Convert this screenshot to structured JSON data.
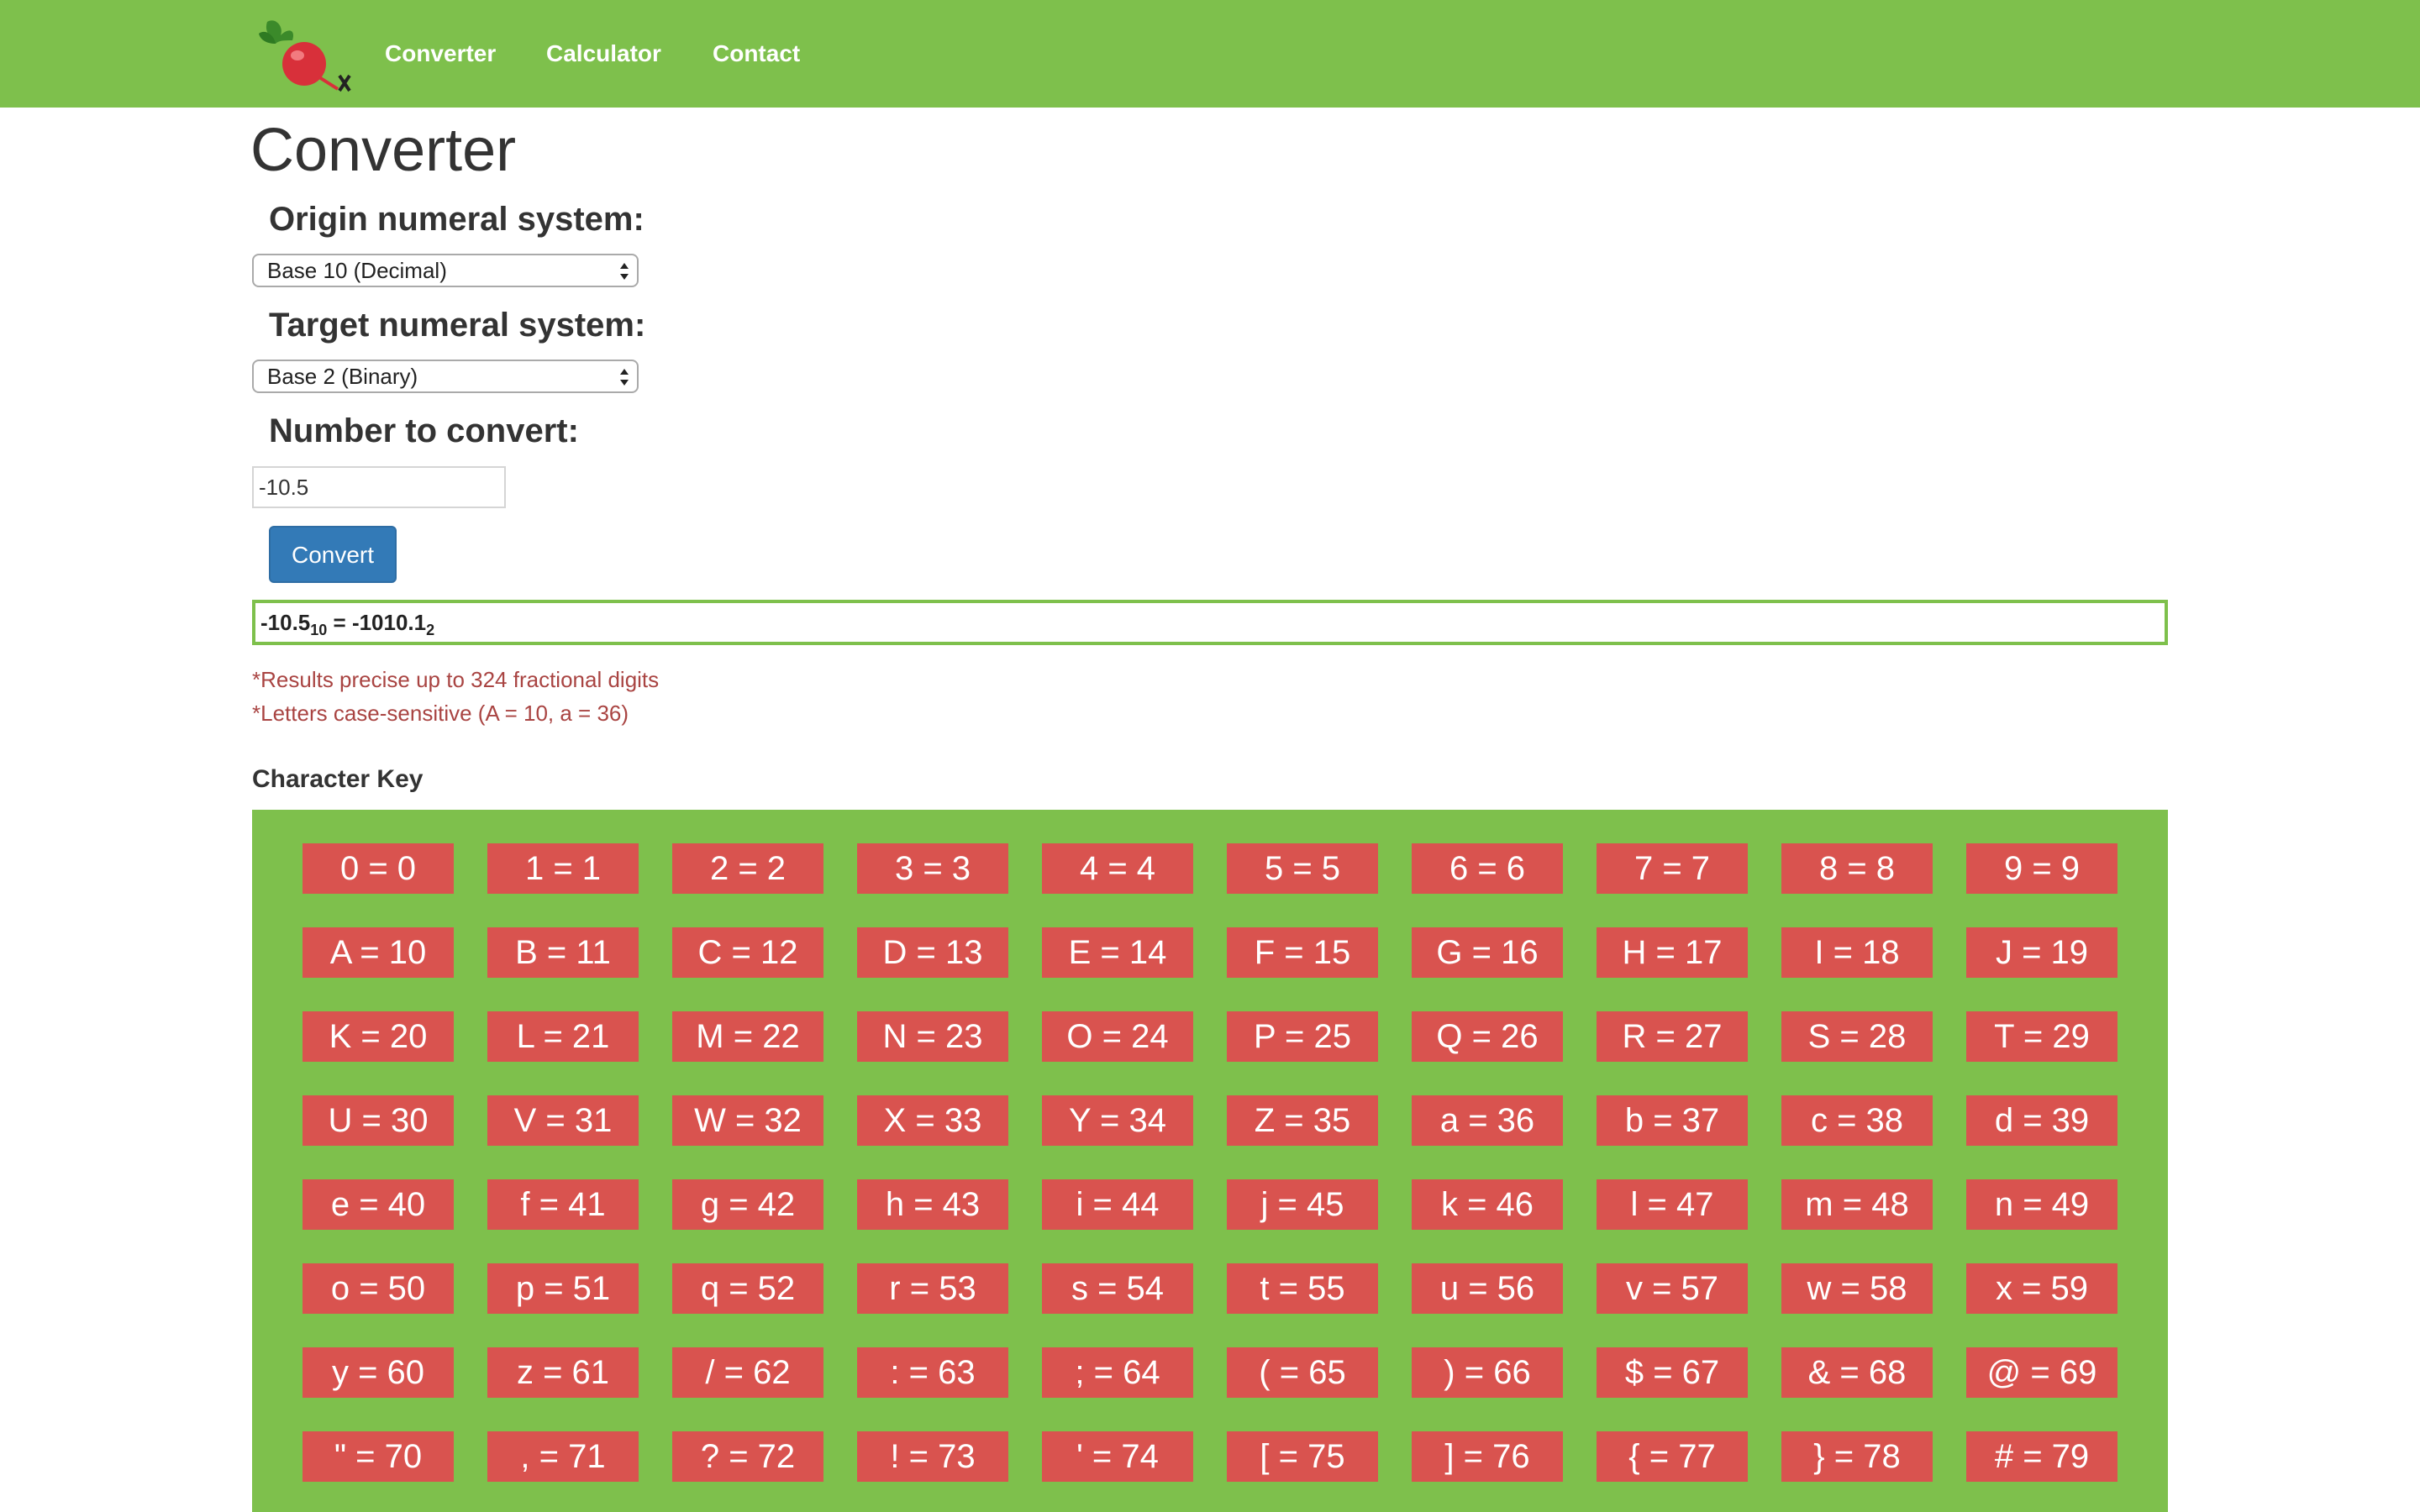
{
  "nav": {
    "links": [
      "Converter",
      "Calculator",
      "Contact"
    ]
  },
  "page": {
    "title": "Converter"
  },
  "form": {
    "origin_label": "Origin numeral system:",
    "origin_value": "Base 10 (Decimal)",
    "target_label": "Target numeral system:",
    "target_value": "Base 2 (Binary)",
    "number_label": "Number to convert:",
    "number_value": "-10.5",
    "convert_label": "Convert"
  },
  "result": {
    "input": "-10.5",
    "input_base": "10",
    "equals": " = ",
    "output": "-1010.1",
    "output_base": "2"
  },
  "notes": [
    "*Results precise up to 324 fractional digits",
    "*Letters case-sensitive (A = 10, a = 36)"
  ],
  "character_key": {
    "title": "Character Key",
    "entries": [
      "0 = 0",
      "1 = 1",
      "2 = 2",
      "3 = 3",
      "4 = 4",
      "5 = 5",
      "6 = 6",
      "7 = 7",
      "8 = 8",
      "9 = 9",
      "A = 10",
      "B = 11",
      "C = 12",
      "D = 13",
      "E = 14",
      "F = 15",
      "G = 16",
      "H = 17",
      "I = 18",
      "J = 19",
      "K = 20",
      "L = 21",
      "M = 22",
      "N = 23",
      "O = 24",
      "P = 25",
      "Q = 26",
      "R = 27",
      "S = 28",
      "T = 29",
      "U = 30",
      "V = 31",
      "W = 32",
      "X = 33",
      "Y = 34",
      "Z = 35",
      "a = 36",
      "b = 37",
      "c = 38",
      "d = 39",
      "e = 40",
      "f = 41",
      "g = 42",
      "h = 43",
      "i = 44",
      "j = 45",
      "k = 46",
      "l = 47",
      "m = 48",
      "n = 49",
      "o = 50",
      "p = 51",
      "q = 52",
      "r = 53",
      "s = 54",
      "t = 55",
      "u = 56",
      "v = 57",
      "w = 58",
      "x = 59",
      "y = 60",
      "z = 61",
      "/ = 62",
      ": = 63",
      "; = 64",
      "( = 65",
      ") = 66",
      "$ = 67",
      "& = 68",
      "@ = 69",
      "\" = 70",
      ", = 71",
      "? = 72",
      "! = 73",
      "' = 74",
      "[ = 75",
      "] = 76",
      "{ = 77",
      "} = 78",
      "# = 79"
    ]
  },
  "colors": {
    "nav_green": "#7ec04c",
    "key_red": "#d9534f",
    "button_blue": "#337ab7",
    "note_red": "#a94442"
  },
  "icons": {
    "logo": "radish-logo-icon",
    "select_arrows": "select-arrows-icon"
  }
}
